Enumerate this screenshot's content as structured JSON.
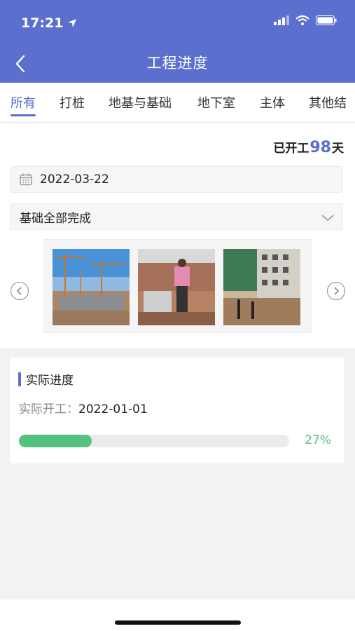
{
  "status_bar": {
    "time": "17:21"
  },
  "header": {
    "title": "工程进度"
  },
  "tabs": [
    {
      "label": "所有",
      "active": true
    },
    {
      "label": "打桩"
    },
    {
      "label": "地基与基础"
    },
    {
      "label": "地下室"
    },
    {
      "label": "主体"
    },
    {
      "label": "其他结"
    }
  ],
  "summary": {
    "prefix": "已开工",
    "days": "98",
    "suffix": "天"
  },
  "date_field": {
    "value": "2022-03-22"
  },
  "stage_select": {
    "value": "基础全部完成"
  },
  "progress": {
    "section_title": "实际进度",
    "start_label": "实际开工：",
    "start_date": "2022-01-01",
    "percent_text": "27%",
    "percent_value": 27
  },
  "colors": {
    "primary": "#5b6fcf",
    "progress": "#52c27e"
  }
}
